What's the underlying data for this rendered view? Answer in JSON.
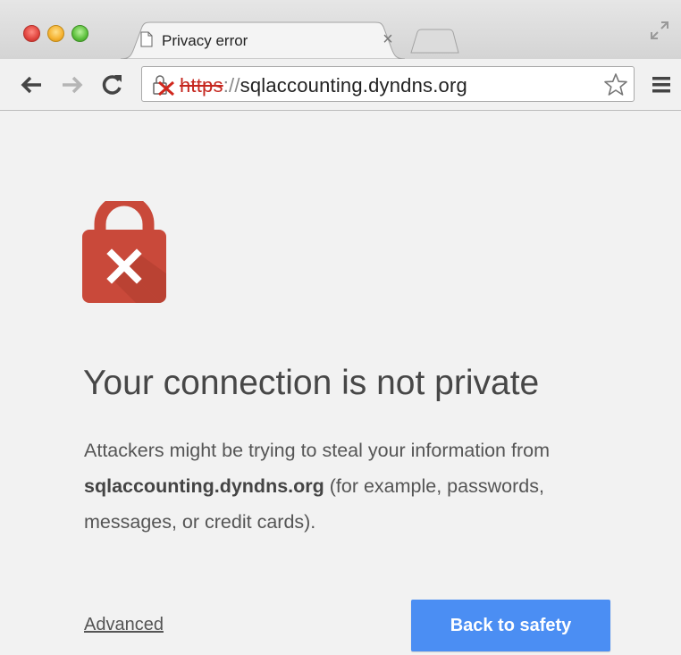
{
  "browser": {
    "tab": {
      "title": "Privacy error",
      "close_label": "×"
    },
    "address_bar": {
      "scheme": "https",
      "separator": "://",
      "host": "sqlaccounting.dyndns.org"
    }
  },
  "page": {
    "heading": "Your connection is not private",
    "description": {
      "prefix": "Attackers might be trying to steal your information from ",
      "domain": "sqlaccounting.dyndns.org",
      "suffix": " (for example, passwords, messages, or credit cards)."
    },
    "advanced_link": "Advanced",
    "back_button": "Back to safety"
  },
  "colors": {
    "error_red": "#c9493a",
    "button_blue": "#4b8ef3",
    "heading_text": "#474747"
  }
}
